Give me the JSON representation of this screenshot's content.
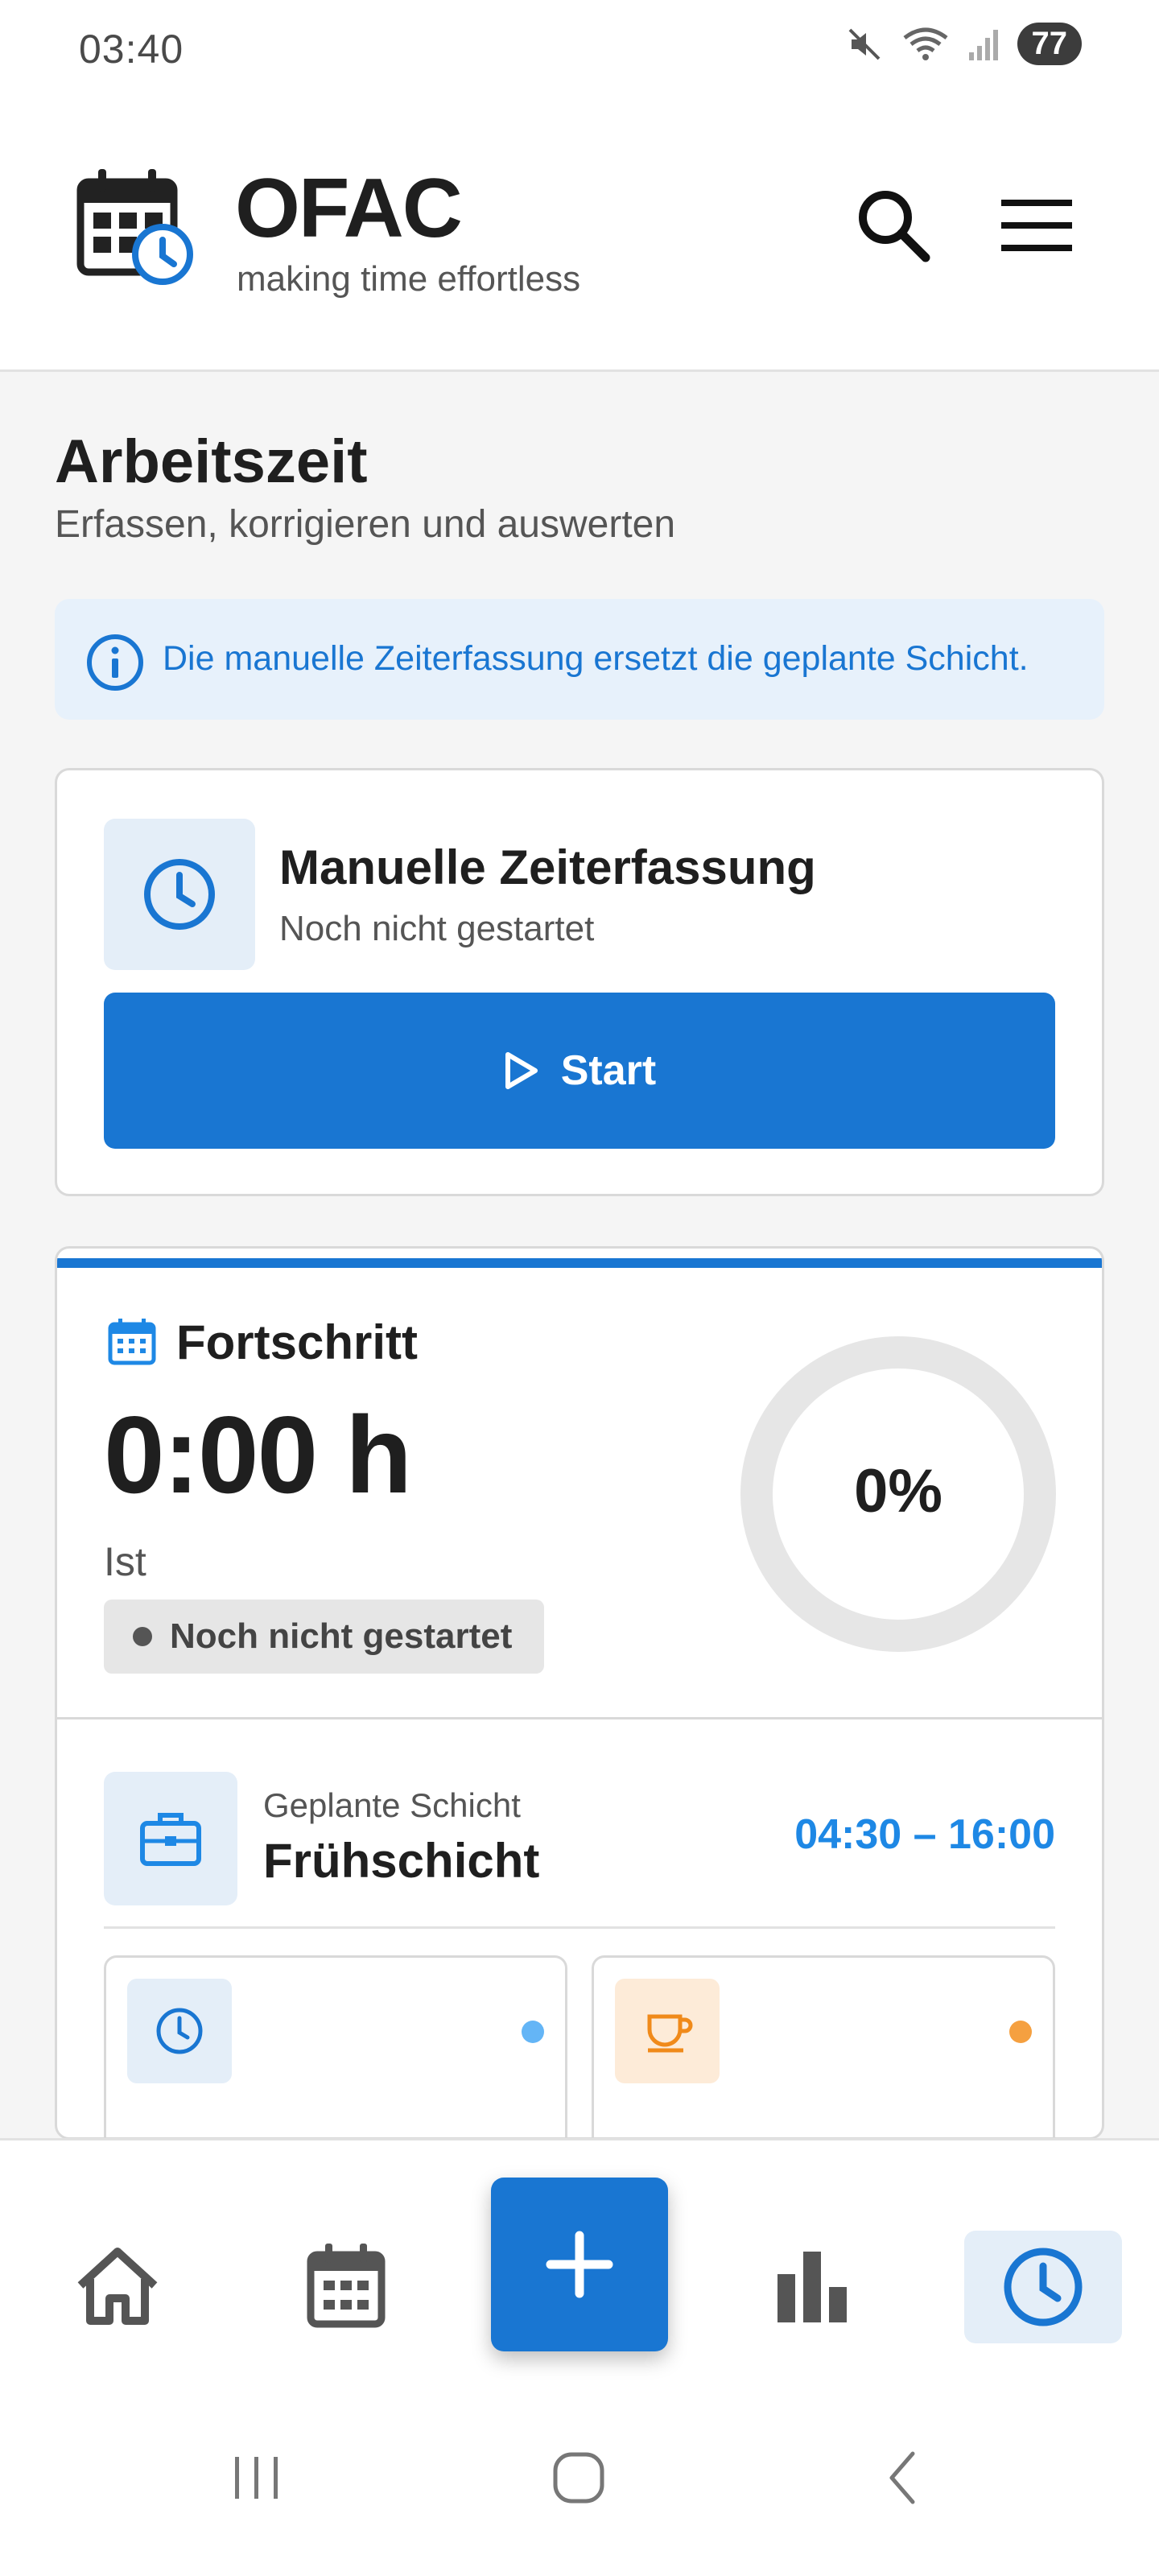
{
  "status_bar": {
    "time": "03:40",
    "battery": "77",
    "icons": [
      "mute-icon",
      "wifi-icon",
      "signal-icon"
    ]
  },
  "app": {
    "title": "OFAC",
    "subtitle": "making time effortless",
    "logo_icon": "calendar-clock-icon"
  },
  "header_actions": {
    "search_icon": "search-icon",
    "menu_icon": "hamburger-menu-icon"
  },
  "page": {
    "title": "Arbeitszeit",
    "subtitle": "Erfassen, korrigieren und auswerten"
  },
  "info_banner": {
    "text": "Die manuelle Zeiterfassung ersetzt die geplante Schicht."
  },
  "manual_card": {
    "title": "Manuelle Zeiterfassung",
    "status": "Noch nicht gestartet",
    "start_label": "Start"
  },
  "progress_card": {
    "title": "Fortschritt",
    "value": "0:00 h",
    "value_label": "Ist",
    "badge": "Noch nicht gestartet",
    "percent_label": "0%",
    "percent": 0
  },
  "shift": {
    "label": "Geplante Schicht",
    "name": "Frühschicht",
    "time": "04:30 – 16:00"
  },
  "mini_cards": [
    {
      "icon": "clock-icon",
      "dot_color": "#64b5f6"
    },
    {
      "icon": "coffee-cup-icon",
      "dot_color": "#f5a040"
    }
  ],
  "bottom_nav": [
    "home-icon",
    "calendar-icon",
    "add-icon",
    "bar-chart-icon",
    "clock-icon"
  ],
  "colors": {
    "accent": "#1976d2",
    "accent_light": "#e4eef8",
    "shift_time": "#1e88e5",
    "break_orange": "#f5a040"
  }
}
